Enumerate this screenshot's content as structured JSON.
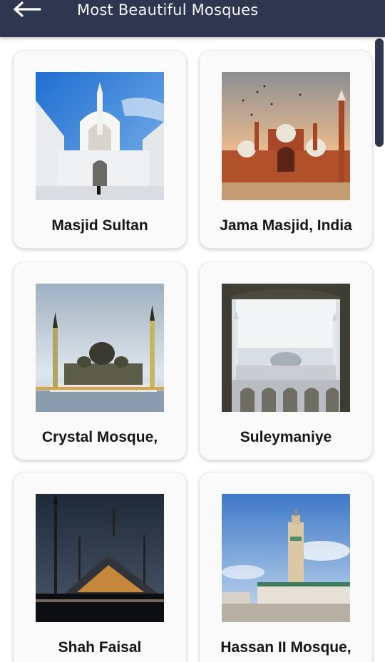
{
  "header": {
    "title": "Most Beautiful Mosques",
    "back_icon": "arrow-left-icon"
  },
  "colors": {
    "appbar": "#2e3650",
    "card_background": "#fafafa",
    "label_text": "#161616"
  },
  "mosques": [
    {
      "name": "Masjid Sultan"
    },
    {
      "name": "Jama Masjid, India"
    },
    {
      "name": "Crystal Mosque,"
    },
    {
      "name": "Suleymaniye"
    },
    {
      "name": "Shah Faisal"
    },
    {
      "name": "Hassan II Mosque,"
    }
  ]
}
